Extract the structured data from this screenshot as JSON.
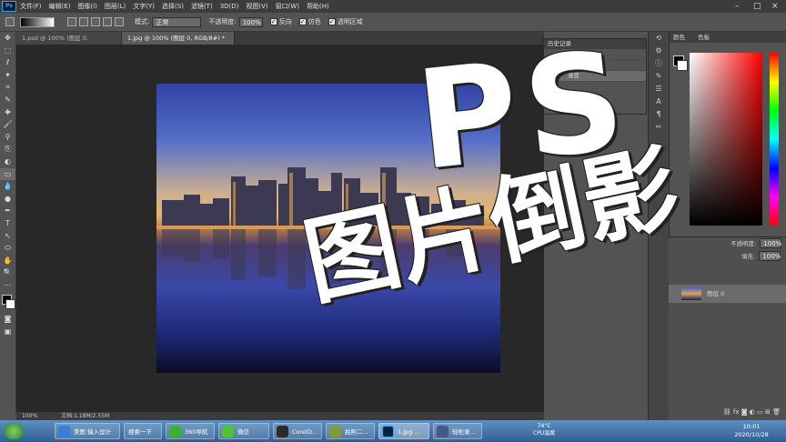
{
  "menubar": {
    "logo": "Ps",
    "items": [
      "文件(F)",
      "编辑(E)",
      "图像(I)",
      "图层(L)",
      "文字(Y)",
      "选择(S)",
      "滤镜(T)",
      "3D(D)",
      "视图(V)",
      "窗口(W)",
      "帮助(H)"
    ],
    "window_controls": [
      "–",
      "□",
      "×"
    ]
  },
  "options": {
    "mode_label": "模式:",
    "mode_value": "正常",
    "opacity_label": "不透明度:",
    "opacity_value": "100%",
    "reverse_label": "反向",
    "dither_label": "仿色",
    "transparency_label": "透明区域"
  },
  "tools": [
    "✥",
    "⬚",
    "ℓ",
    "✦",
    "⌗",
    "✎",
    "✚",
    "🖌",
    "⚲",
    "⎘",
    "◐",
    "▭",
    "💧",
    "●",
    "✒",
    "T",
    "↖",
    "⬭",
    "✋",
    "🔍",
    "⋯"
  ],
  "tabs": [
    {
      "label": "1.psd @ 100% (图层 0, RGB/8#) ×"
    },
    {
      "label": "1.jpg @ 100% (图层 0, RGB/8#) * ×"
    }
  ],
  "status": {
    "zoom": "100%",
    "doc": "文档:1.18M/2.55M"
  },
  "history_panel": {
    "title": "历史记录",
    "rows": [
      "重排图",
      "渐变图层",
      "渐变"
    ]
  },
  "color_panel": {
    "tabs": [
      "颜色",
      "色板"
    ]
  },
  "layers_panel": {
    "opacity_label": "不透明度:",
    "opacity_value": "100%",
    "fill_label": "填充:",
    "fill_value": "100%",
    "layer_name": "图层 0"
  },
  "overlay": {
    "line1": "PS",
    "line2": "图片倒影"
  },
  "taskbar": {
    "items": [
      {
        "label": "美图 输入设计",
        "color": "#3a7fd0"
      },
      {
        "label": "搜索一下",
        "color": "#5b9ad8"
      },
      {
        "label": "360导航",
        "color": "#3cb034"
      },
      {
        "label": "微信",
        "color": "#4cc43a"
      },
      {
        "label": "CorelD...",
        "color": "#2b2b2b"
      },
      {
        "label": "拍照二...",
        "color": "#7b9b3d"
      },
      {
        "label": "1.jpg ...",
        "color": "#0b1f37"
      },
      {
        "label": "轻松录...",
        "color": "#465a8a"
      }
    ],
    "temp": "74°C",
    "cpu": "CPU温度",
    "time": "10:01",
    "date": "2020/10/28"
  },
  "colors": {
    "ps_blue": "#31a8ff",
    "workspace": "#535353",
    "canvas_bg": "#282828"
  }
}
